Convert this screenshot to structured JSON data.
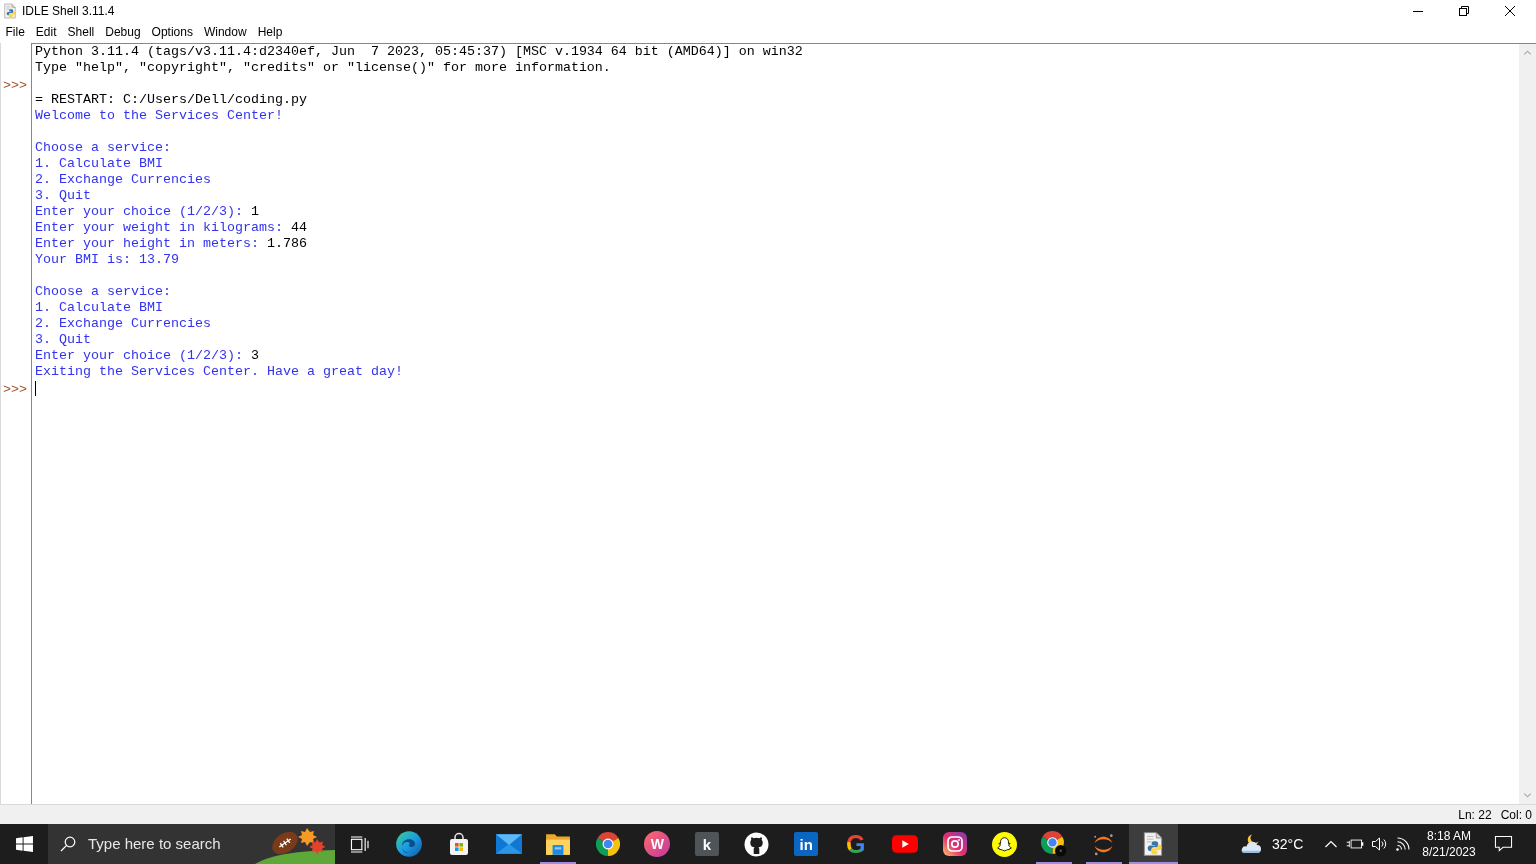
{
  "window": {
    "title": "IDLE Shell 3.11.4"
  },
  "menu": [
    "File",
    "Edit",
    "Shell",
    "Debug",
    "Options",
    "Window",
    "Help"
  ],
  "shell": {
    "cursor": true,
    "blocks": [
      {
        "lines": [
          {
            "segments": [
              {
                "kind": "plain",
                "text": "Python 3.11.4 (tags/v3.11.4:d2340ef, Jun  7 2023, 05:45:37) [MSC v.1934 64 bit (AMD64)] on win32"
              }
            ]
          },
          {
            "segments": [
              {
                "kind": "plain",
                "text": "Type \"help\", \"copyright\", \"credits\" or \"license()\" for more information."
              }
            ]
          },
          {
            "prompt": ">>>"
          },
          {
            "segments": [
              {
                "kind": "plain",
                "text": "= RESTART: C:/Users/Dell/coding.py"
              }
            ]
          },
          {
            "segments": [
              {
                "kind": "output",
                "text": "Welcome to the Services Center!"
              }
            ]
          }
        ]
      },
      {
        "lines": [
          {
            "segments": [
              {
                "kind": "output",
                "text": "Choose a service:"
              }
            ]
          },
          {
            "segments": [
              {
                "kind": "output",
                "text": "1. Calculate BMI"
              }
            ]
          },
          {
            "segments": [
              {
                "kind": "output",
                "text": "2. Exchange Currencies"
              }
            ]
          },
          {
            "segments": [
              {
                "kind": "output",
                "text": "3. Quit"
              }
            ]
          },
          {
            "segments": [
              {
                "kind": "output",
                "text": "Enter your choice (1/2/3): "
              },
              {
                "kind": "plain",
                "text": "1"
              }
            ]
          },
          {
            "segments": [
              {
                "kind": "output",
                "text": "Enter your weight in kilograms: "
              },
              {
                "kind": "plain",
                "text": "44"
              }
            ]
          },
          {
            "segments": [
              {
                "kind": "output",
                "text": "Enter your height in meters: "
              },
              {
                "kind": "plain",
                "text": "1.786"
              }
            ]
          },
          {
            "segments": [
              {
                "kind": "output",
                "text": "Your BMI is: 13.79"
              }
            ]
          }
        ]
      },
      {
        "lines": [
          {
            "segments": [
              {
                "kind": "output",
                "text": "Choose a service:"
              }
            ]
          },
          {
            "segments": [
              {
                "kind": "output",
                "text": "1. Calculate BMI"
              }
            ]
          },
          {
            "segments": [
              {
                "kind": "output",
                "text": "2. Exchange Currencies"
              }
            ]
          },
          {
            "segments": [
              {
                "kind": "output",
                "text": "3. Quit"
              }
            ]
          },
          {
            "segments": [
              {
                "kind": "output",
                "text": "Enter your choice (1/2/3): "
              },
              {
                "kind": "plain",
                "text": "3"
              }
            ]
          },
          {
            "segments": [
              {
                "kind": "output",
                "text": "Exiting the Services Center. Have a great day!"
              }
            ]
          },
          {
            "prompt": ">>>"
          }
        ]
      }
    ]
  },
  "status_bar": {
    "line": "Ln: 22",
    "column": "Col: 0"
  },
  "taskbar": {
    "search": {
      "placeholder": "Type here to search"
    },
    "apps": [
      {
        "kind": "swirl",
        "running": false,
        "selected": false
      },
      {
        "kind": "bag",
        "running": false,
        "selected": false
      },
      {
        "kind": "envelope",
        "running": false,
        "selected": false
      },
      {
        "kind": "folder",
        "running": true,
        "selected": false
      },
      {
        "kind": "tricolor",
        "running": false,
        "selected": false
      },
      {
        "kind": "disc",
        "label": "W",
        "running": false,
        "selected": false
      },
      {
        "kind": "tile",
        "label": "k",
        "color": "#4f5458",
        "running": false,
        "selected": false
      },
      {
        "kind": "cat",
        "running": false,
        "selected": false
      },
      {
        "kind": "tile",
        "label": "in",
        "color": "#0a66c2",
        "running": false,
        "selected": false
      },
      {
        "kind": "letter",
        "label": "G",
        "running": false,
        "selected": false
      },
      {
        "kind": "play",
        "running": false,
        "selected": false
      },
      {
        "kind": "camera",
        "running": false,
        "selected": false
      },
      {
        "kind": "ghost",
        "running": false,
        "selected": false
      },
      {
        "kind": "badged",
        "running": true,
        "selected": false
      },
      {
        "kind": "arcs",
        "running": true,
        "selected": false
      },
      {
        "kind": "snake",
        "running": true,
        "selected": true
      }
    ],
    "weather": {
      "temperature": "32°C"
    },
    "clock": {
      "time": "8:18 AM",
      "date": "8/21/2023"
    }
  }
}
